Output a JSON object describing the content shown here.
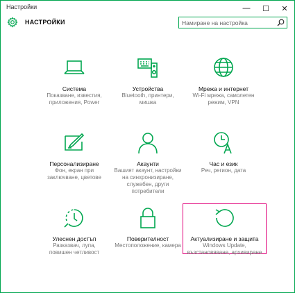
{
  "window": {
    "title": "Настройки"
  },
  "controls": {
    "minimize": "—",
    "maximize": "☐",
    "close": "✕"
  },
  "header": {
    "title": "НАСТРОЙКИ",
    "icon": "gear-icon"
  },
  "search": {
    "placeholder": "Намиране на настройка",
    "icon": "search-icon"
  },
  "accent_color": "#00a64f",
  "selection_color": "#e0007a",
  "tiles": [
    {
      "id": "system",
      "icon": "laptop-icon",
      "name": "Система",
      "desc1": "Показване, известия,",
      "desc2": "приложения, Power"
    },
    {
      "id": "devices",
      "icon": "devices-icon",
      "name": "Устройства",
      "desc1": "Bluetooth, принтери,",
      "desc2": "мишка"
    },
    {
      "id": "network",
      "icon": "globe-icon",
      "name": "Мрежа и интернет",
      "desc1": "Wi-Fi мрежа, самолетен",
      "desc2": "режим, VPN"
    },
    {
      "id": "personalization",
      "icon": "paintbrush-icon",
      "name": "Персонализиране",
      "desc1": "Фон, екран при",
      "desc2": "заключване, цветове"
    },
    {
      "id": "accounts",
      "icon": "person-icon",
      "name": "Акаунти",
      "desc1": "Вашият акаунт, настройки",
      "desc2": "на синхронизиране,",
      "desc3": "служебен, други",
      "desc4": "потребители"
    },
    {
      "id": "time",
      "icon": "clock-language-icon",
      "name": "Час и език",
      "desc1": "Реч, регион, дата"
    },
    {
      "id": "ease",
      "icon": "ease-of-access-icon",
      "name": "Улеснен достъп",
      "desc1": "Разказвач, лупа,",
      "desc2": "повишен четливост"
    },
    {
      "id": "privacy",
      "icon": "lock-icon",
      "name": "Поверителност",
      "desc1": "Местоположение, камера"
    },
    {
      "id": "update",
      "icon": "refresh-icon",
      "name": "Актуализиране и защита",
      "desc1": "Windows Update,",
      "desc2": "възстановяване, архивиране",
      "selected": true
    }
  ]
}
